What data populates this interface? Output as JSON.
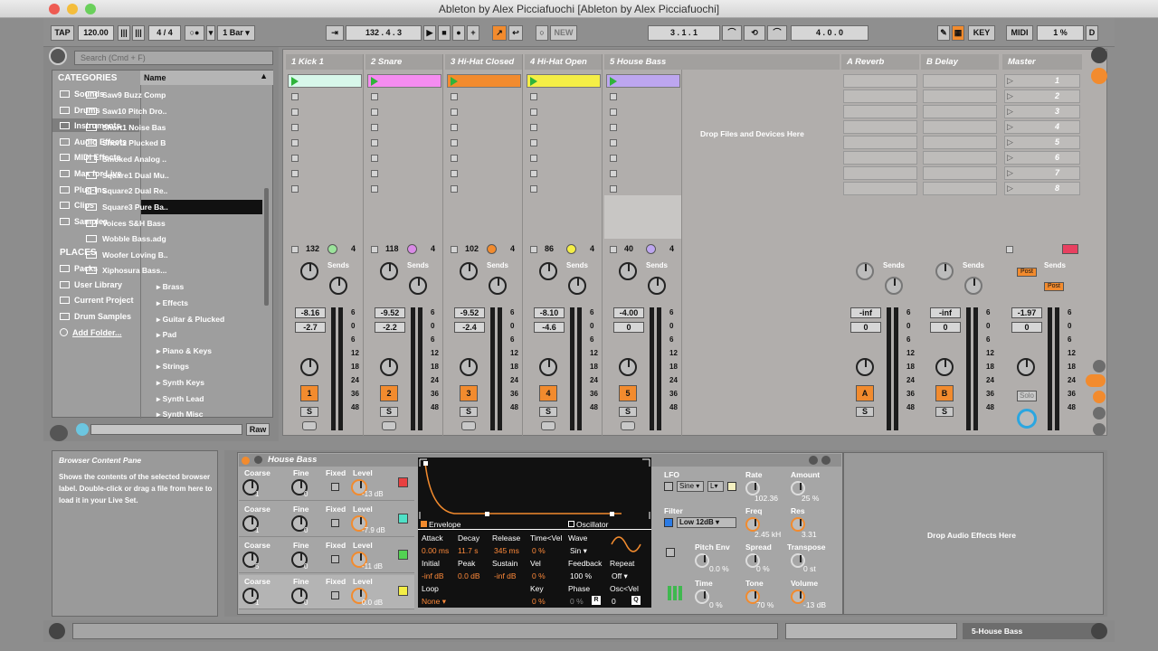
{
  "window": {
    "title": "Ableton by Alex Picciafuochi  [Ableton by Alex Picciafuochi]"
  },
  "control_bar": {
    "tap": "TAP",
    "tempo": "120.00",
    "sig": "4 / 4",
    "metro": "○●",
    "quant": "1 Bar",
    "arr_pos": "132 .   4 .   3",
    "loop_start": "3 .   1 .   1",
    "loop_len": "4 .   0 .   0",
    "new": "NEW",
    "key": "KEY",
    "midi": "MIDI",
    "cpu": "1 %",
    "d": "D"
  },
  "browser": {
    "search_placeholder": "Search (Cmd + F)",
    "categories_title": "CATEGORIES",
    "name_col": "Name",
    "categories": [
      "Sounds",
      "Drums",
      "Instruments",
      "Audio Effects",
      "MIDI Effects",
      "Max for Live",
      "Plug-ins",
      "Clips",
      "Samples"
    ],
    "places_title": "PLACES",
    "places": [
      "Packs",
      "User Library",
      "Current Project",
      "Drum Samples",
      "Add Folder..."
    ],
    "files": [
      "Saw9 Buzz Comp",
      "Saw10 Pitch Dro..",
      "Short1 Noise Bas",
      "Short2 Plucked B",
      "Smoked Analog ..",
      "Square1 Dual Mu..",
      "Square2 Dual Re..",
      "Square3 Pure Ba..",
      "Voices S&H Bass",
      "Wobble Bass.adg",
      "Woofer Loving B..",
      "Xiphosura Bass..."
    ],
    "folders": [
      "Brass",
      "Effects",
      "Guitar & Plucked",
      "Pad",
      "Piano & Keys",
      "Strings",
      "Synth Keys",
      "Synth Lead",
      "Synth Misc"
    ],
    "raw": "Raw"
  },
  "tracks": [
    {
      "name": "1 Kick 1",
      "clip_color": "#d8f7ea",
      "num": "132",
      "dot": "#9be39b",
      "vol": "-8.16",
      "peak": "-2.7",
      "act": "1"
    },
    {
      "name": "2 Snare",
      "clip_color": "#f58cf0",
      "num": "118",
      "dot": "#d98ae6",
      "vol": "-9.52",
      "peak": "-2.2",
      "act": "2"
    },
    {
      "name": "3 Hi-Hat Closed",
      "clip_color": "#f28b2e",
      "num": "102",
      "dot": "#f28b2e",
      "vol": "-9.52",
      "peak": "-2.4",
      "act": "3"
    },
    {
      "name": "4 Hi-Hat Open",
      "clip_color": "#f4ee46",
      "num": "86",
      "dot": "#f4ee46",
      "vol": "-8.10",
      "peak": "-4.6",
      "act": "4"
    },
    {
      "name": "5 House Bass",
      "clip_color": "#bda6ef",
      "num": "40",
      "dot": "#bda6ef",
      "vol": "-4.00",
      "peak": "0",
      "act": "5"
    }
  ],
  "returns": [
    {
      "name": "A Reverb",
      "vol": "-inf",
      "peak": "0",
      "act": "A"
    },
    {
      "name": "B Delay",
      "vol": "-inf",
      "peak": "0",
      "act": "B"
    }
  ],
  "master": {
    "name": "Master",
    "scenes": [
      "1",
      "2",
      "3",
      "4",
      "5",
      "6",
      "7",
      "8"
    ],
    "vol": "-1.97",
    "peak": "0",
    "solo": "Solo",
    "post": "Post"
  },
  "session": {
    "drop": "Drop Files and Devices Here",
    "sends": "Sends",
    "solo": "S"
  },
  "meter_scale": [
    "6",
    "0",
    "6",
    "12",
    "18",
    "24",
    "36",
    "48"
  ],
  "info": {
    "title": "Browser Content Pane",
    "text": "Shows the contents of the selected browser label. Double-click or drag a file from here to load it in your Live Set."
  },
  "device": {
    "name": "House Bass",
    "ops": [
      {
        "coarse": "1",
        "fine": "0",
        "level": "-13 dB",
        "color": "#e84040"
      },
      {
        "coarse": "1",
        "fine": "0",
        "level": "-7.9 dB",
        "color": "#4fe0c6"
      },
      {
        "coarse": "5",
        "fine": "0",
        "level": "-11 dB",
        "color": "#52d152"
      },
      {
        "coarse": "1",
        "fine": "0",
        "level": "0.0 dB",
        "color": "#f4ee46"
      }
    ],
    "labels": {
      "coarse": "Coarse",
      "fine": "Fine",
      "fixed": "Fixed",
      "level": "Level"
    },
    "env": {
      "envelope": "Envelope",
      "oscillator": "Oscillator",
      "attack": "Attack",
      "attack_v": "0.00 ms",
      "decay": "Decay",
      "decay_v": "11.7 s",
      "release": "Release",
      "release_v": "345 ms",
      "timevel": "Time<Vel",
      "timevel_v": "0 %",
      "wave": "Wave",
      "wave_v": "Sin",
      "initial": "Initial",
      "initial_v": "-inf dB",
      "peak": "Peak",
      "peak_v": "0.0 dB",
      "sustain": "Sustain",
      "sustain_v": "-inf dB",
      "vel": "Vel",
      "vel_v": "0 %",
      "feedback": "Feedback",
      "feedback_v": "100 %",
      "repeat": "Repeat",
      "repeat_v": "Off",
      "loop": "Loop",
      "loop_v": "None",
      "key": "Key",
      "key_v": "0 %",
      "phase": "Phase",
      "phase_v": "0 %",
      "oscvel": "Osc<Vel",
      "oscvel_v": "0",
      "r": "R",
      "q": "Q"
    },
    "lfo": {
      "lfo": "LFO",
      "sine": "Sine",
      "l": "L",
      "rate": "Rate",
      "rate_v": "102.36",
      "amount": "Amount",
      "amount_v": "25 %",
      "filter": "Filter",
      "filter_type": "Low 12dB",
      "freq": "Freq",
      "freq_v": "2.45 kH",
      "res": "Res",
      "res_v": "3.31",
      "pitchenv": "Pitch Env",
      "pitchenv_v": "0.0 %",
      "spread": "Spread",
      "spread_v": "0 %",
      "transpose": "Transpose",
      "transpose_v": "0 st",
      "time": "Time",
      "time_v": "0 %",
      "tone": "Tone",
      "tone_v": "70 %",
      "volume": "Volume",
      "volume_v": "-13 dB"
    },
    "drop_fx": "Drop Audio Effects Here"
  },
  "status": {
    "track": "5-House Bass"
  }
}
